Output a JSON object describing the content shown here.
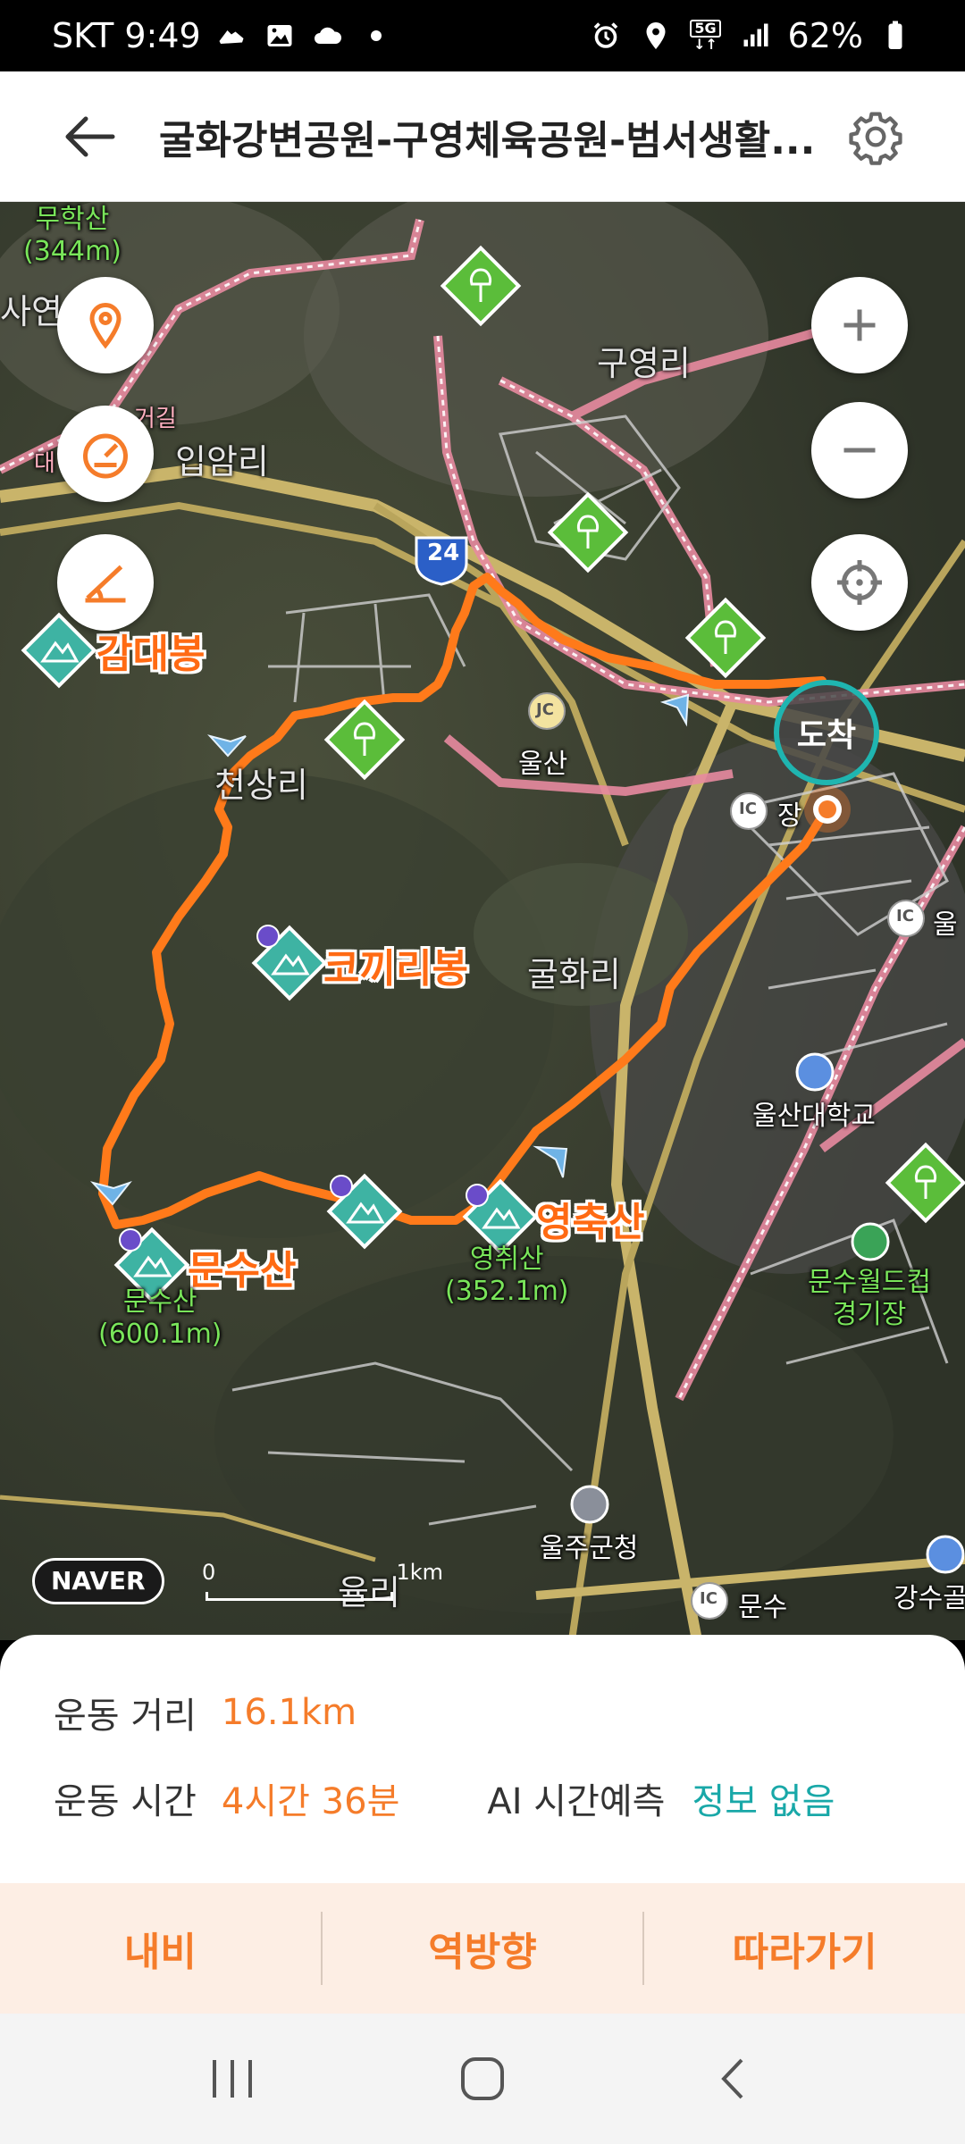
{
  "status_bar": {
    "carrier_time": "SKT 9:49",
    "network": "5G",
    "battery": "62%",
    "left_icons": [
      "sneaker-icon",
      "image-icon",
      "cloud-icon",
      "dot-icon"
    ],
    "right_icons": [
      "alarm-icon",
      "location-icon",
      "5g-icon",
      "signal-icon",
      "battery-icon"
    ]
  },
  "header": {
    "title": "굴화강변공원-구영체육공원-범서생활...",
    "back_icon": "back-arrow-icon",
    "settings_icon": "gear-icon"
  },
  "map": {
    "peaks": [
      {
        "name": "감대봉"
      },
      {
        "name": "코끼리봉"
      },
      {
        "name": "문수산"
      },
      {
        "name": "영축산"
      }
    ],
    "peak_subs": {
      "munsu": [
        "문수산",
        "(600.1m)"
      ],
      "yeongchwi": [
        "영취산",
        "(352.1m)"
      ],
      "muhak": [
        "무학산",
        "(344m)"
      ]
    },
    "areas": [
      "구영리",
      "입암리",
      "천상리",
      "굴화리",
      "울산",
      "울산대학교",
      "울주군청",
      "문수",
      "강수골",
      "장",
      "울",
      "사연",
      "율리",
      "대"
    ],
    "green_places": {
      "munsu_cup": [
        "문수월드컵",
        "경기장"
      ],
      "trail": "거길"
    },
    "road_number": "24",
    "ic_labels": [
      "IC",
      "IC",
      "IC",
      "JC"
    ],
    "arrival": "도착",
    "naver": "NAVER",
    "scale": {
      "zero": "0",
      "unit": "1km"
    },
    "route_color": "#ff7a1a"
  },
  "stats": {
    "distance_label": "운동 거리",
    "distance_value": "16.1km",
    "time_label": "운동 시간",
    "time_value": "4시간 36분",
    "ai_label": "AI 시간예측",
    "ai_value": "정보 없음"
  },
  "actions": {
    "navi": "내비",
    "reverse": "역방향",
    "follow": "따라가기"
  },
  "colors": {
    "accent": "#f57c2a",
    "ai_teal": "#19a8a8",
    "action_bg": "#fdeee4"
  }
}
